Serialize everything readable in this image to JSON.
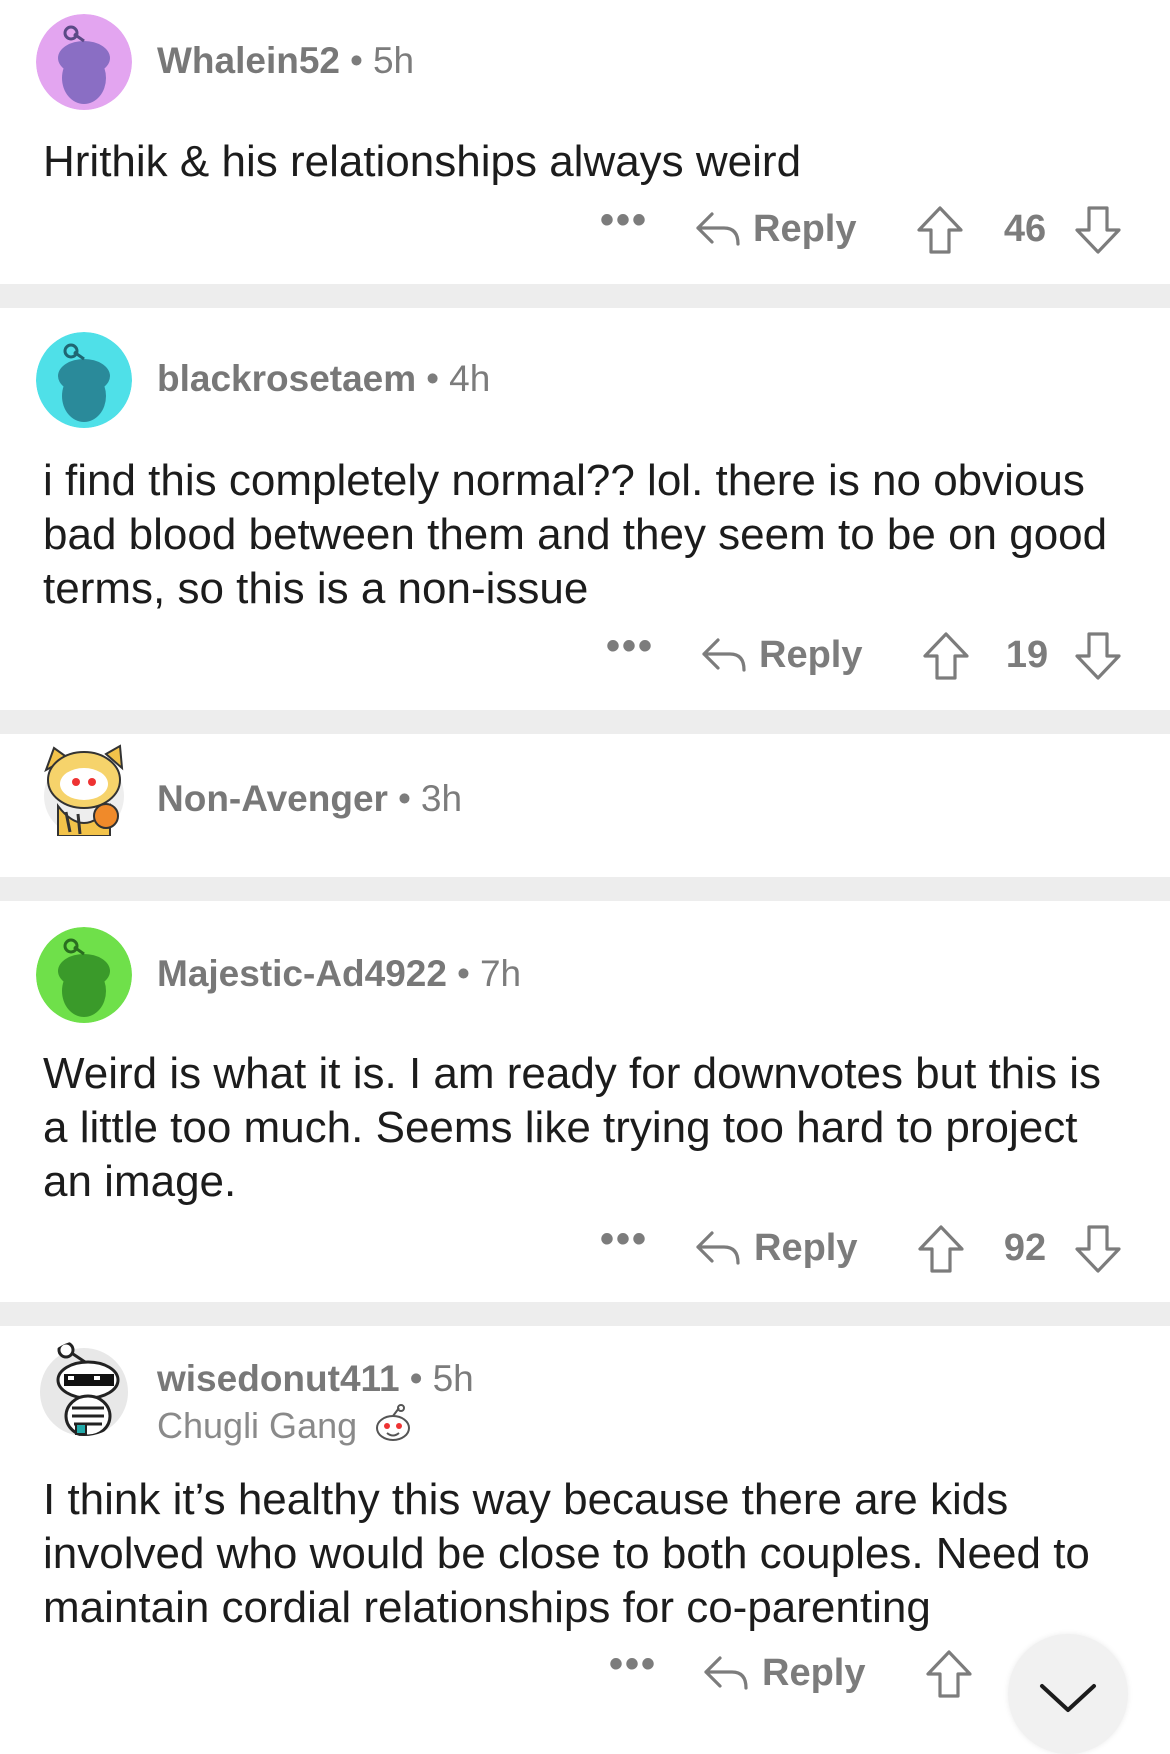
{
  "comments": [
    {
      "username": "Whalein52",
      "age": "5h",
      "body": "Hrithik & his relationships always weird",
      "reply_label": "Reply",
      "score": "46",
      "more": "•••",
      "avatar_color": "#e3a5f0"
    },
    {
      "username": "blackrosetaem",
      "age": "4h",
      "body": "i find this completely normal?? lol. there is no obvious bad blood between them and they seem to be on good terms, so this is a non-issue",
      "reply_label": "Reply",
      "score": "19",
      "more": "•••",
      "avatar_color": "#4fe0e8"
    },
    {
      "username": "Non-Avenger",
      "age": "3h",
      "avatar_color": "#f3c34a"
    },
    {
      "username": "Majestic-Ad4922",
      "age": "7h",
      "body": "Weird is what it is. I am ready for downvotes but this is a little too much. Seems like trying too hard to project an image.",
      "reply_label": "Reply",
      "score": "92",
      "more": "•••",
      "avatar_color": "#6fe04a"
    },
    {
      "username": "wisedonut411",
      "age": "5h",
      "flair": "Chugli Gang",
      "body": "I think it’s healthy this way because there are kids involved who would be close to both couples. Need to maintain cordial relationships for co-parenting",
      "reply_label": "Reply",
      "more": "•••",
      "avatar_color": "#e8e8e8"
    }
  ],
  "separator": "•",
  "icons": [
    "reply-arrow-icon",
    "upvote-arrow-icon",
    "downvote-arrow-icon",
    "more-dots-icon",
    "collapse-chevron-icon",
    "snoo-avatar-icon"
  ],
  "colors": {
    "text": "#1c1c1c",
    "muted": "#7c7c7c",
    "divider": "#ededed"
  }
}
